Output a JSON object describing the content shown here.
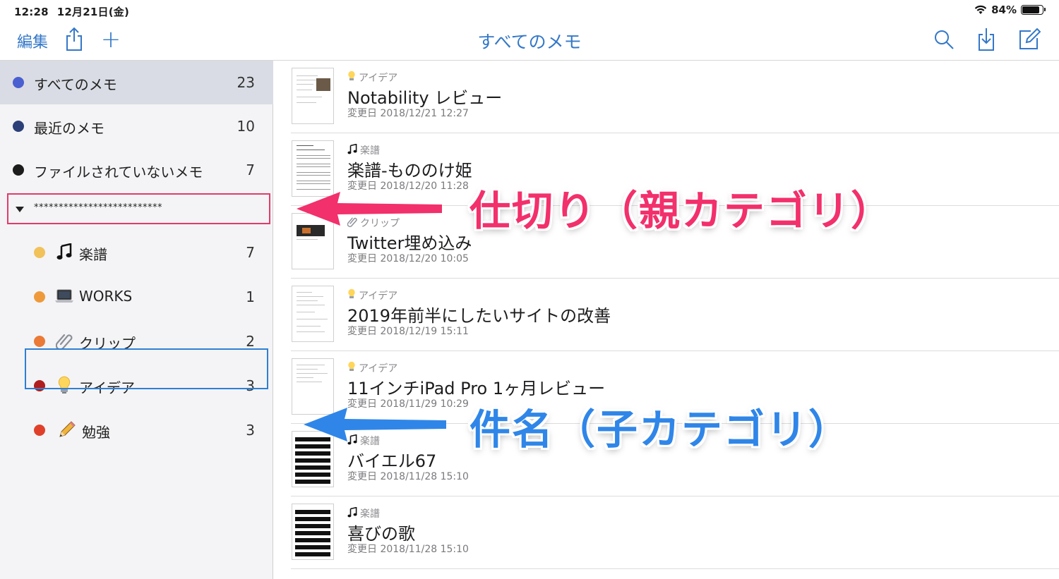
{
  "status_bar": {
    "time": "12:28",
    "date": "12月21日(金)",
    "battery_text": "84%",
    "battery_level": 0.84
  },
  "nav": {
    "edit_label": "編集",
    "add_label": "+",
    "title": "すべてのメモ"
  },
  "sidebar": {
    "items": [
      {
        "label": "すべてのメモ",
        "count": "23",
        "color": "#4a5fd0"
      },
      {
        "label": "最近のメモ",
        "count": "10",
        "color": "#2c3f78"
      },
      {
        "label": "ファイルされていないメモ",
        "count": "7",
        "color": "#1c1c1c"
      }
    ],
    "divider_label": "**************************",
    "children": [
      {
        "emoji": "music-note-icon",
        "label": "楽譜",
        "count": "7",
        "color": "#f1c15a"
      },
      {
        "emoji": "laptop-icon",
        "label": "WORKS",
        "count": "1",
        "color": "#ee9a3b"
      },
      {
        "emoji": "paperclip-icon",
        "label": "クリップ",
        "count": "2",
        "color": "#ea7a35"
      },
      {
        "emoji": "lightbulb-icon",
        "label": "アイデア",
        "count": "3",
        "color": "#b01e1e"
      },
      {
        "emoji": "pencil-icon",
        "label": "勉強",
        "count": "3",
        "color": "#e0402a"
      }
    ]
  },
  "notes": [
    {
      "category_icon": "lightbulb-icon",
      "category": "アイデア",
      "title": "Notability レビュー",
      "date": "変更日 2018/12/21 12:27"
    },
    {
      "category_icon": "music-note-icon",
      "category": "楽譜",
      "title": "楽譜-もののけ姫",
      "date": "変更日 2018/12/20 11:28"
    },
    {
      "category_icon": "paperclip-icon",
      "category": "クリップ",
      "title": "Twitter埋め込み",
      "date": "変更日 2018/12/20 10:05"
    },
    {
      "category_icon": "lightbulb-icon",
      "category": "アイデア",
      "title": "2019年前半にしたいサイトの改善",
      "date": "変更日 2018/12/19 15:11"
    },
    {
      "category_icon": "lightbulb-icon",
      "category": "アイデア",
      "title": "11インチiPad Pro 1ヶ月レビュー",
      "date": "変更日 2018/11/29 10:29"
    },
    {
      "category_icon": "music-note-icon",
      "category": "楽譜",
      "title": "バイエル67",
      "date": "変更日 2018/11/28 15:10"
    },
    {
      "category_icon": "music-note-icon",
      "category": "楽譜",
      "title": "喜びの歌",
      "date": "変更日 2018/11/28 15:10"
    }
  ],
  "annotations": {
    "parent_label": "仕切り（親カテゴリ）",
    "child_label": "件名（子カテゴリ）",
    "parent_color": "#f2306b",
    "child_color": "#2f86e8"
  }
}
